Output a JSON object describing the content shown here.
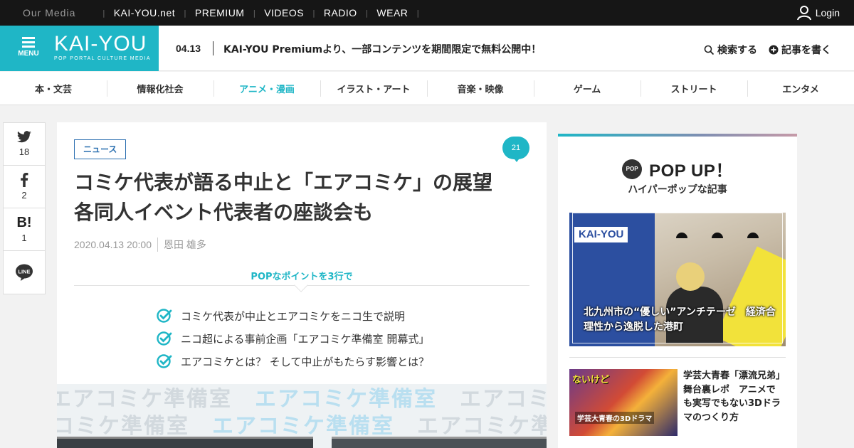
{
  "topbar": {
    "our_media": "Our Media",
    "links": [
      "KAI-YOU.net",
      "PREMIUM",
      "VIDEOS",
      "RADIO",
      "WEAR"
    ],
    "login": "Login"
  },
  "header": {
    "menu_label": "MENU",
    "logo": "KAI-YOU",
    "logo_sub": "POP PORTAL CULTURE MEDIA",
    "news_date": "04.13",
    "news_text": "KAI-YOU Premiumより、一部コンテンツを期間限定で無料公開中！",
    "search": "検索する",
    "write": "記事を書く"
  },
  "categories": [
    "本・文芸",
    "情報化社会",
    "アニメ・漫画",
    "イラスト・アート",
    "音楽・映像",
    "ゲーム",
    "ストリート",
    "エンタメ"
  ],
  "active_category": "アニメ・漫画",
  "share": {
    "twitter": "18",
    "facebook": "2",
    "hatena_label": "B!",
    "hatena": "1",
    "line_label": "LINE"
  },
  "article": {
    "tag": "ニュース",
    "comments": "21",
    "title_line1": "コミケ代表が語る中止と「エアコミケ」の展望",
    "title_line2": "各同人イベント代表者の座談会も",
    "date": "2020.04.13 20:00",
    "author": "恩田 雄多",
    "pop_label": "POPなポイントを3行で",
    "points": [
      "コミケ代表が中止とエアコミケをニコ生で説明",
      "ニコ超による事前企画「エアコミケ準備室 開幕式」",
      "エアコミケとは？ そして中止がもたらす影響とは？"
    ],
    "hero_text": "エアコミケ準備室"
  },
  "sidebar": {
    "pop_badge": "POP",
    "title": "POP UP！",
    "subtitle": "ハイパーポップな記事",
    "feature": {
      "brand": "KAI-YOU",
      "caption": "北九州市の“優しい”アンチテーゼ　経済合理性から逸脱した港町"
    },
    "item2": {
      "thumb_text": "ないけど",
      "thumb_sub": "学芸大青春の3Dドラマ",
      "title": "学芸大青春「漂流兄弟」舞台裏レポ　アニメでも実写でもない3Dドラマのつくり方"
    }
  },
  "colors": {
    "accent": "#1fb6c6",
    "tag_blue": "#2b6fb0",
    "topbar": "#161616"
  }
}
